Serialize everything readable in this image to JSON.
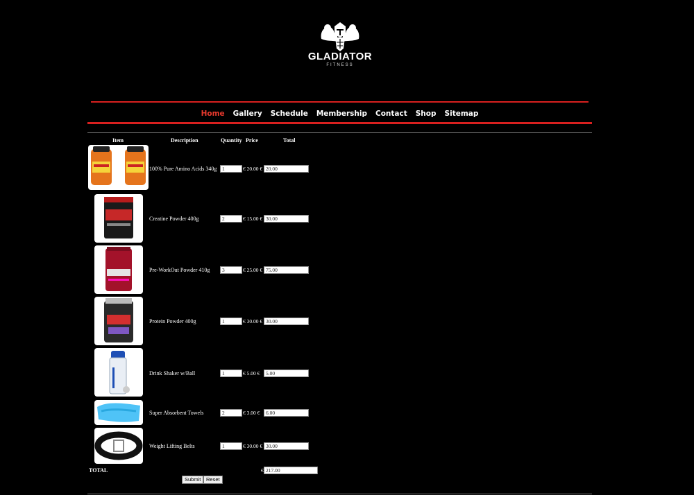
{
  "logo": {
    "brand": "GLADIATOR",
    "sub": "FITNESS"
  },
  "nav": {
    "items": [
      "Home",
      "Gallery",
      "Schedule",
      "Membership",
      "Contact",
      "Shop",
      "Sitemap"
    ],
    "active": "Home"
  },
  "table": {
    "headers": {
      "item": "Item",
      "description": "Description",
      "quantity": "Quantity",
      "price": "Price",
      "total": "Total"
    },
    "rows": [
      {
        "description": "100% Pure Amino Acids 340g",
        "quantity": "1",
        "price": "€ 20.00 €",
        "total": "20.00"
      },
      {
        "description": "Creatine Powder 400g",
        "quantity": "2",
        "price": "€ 15.00 €",
        "total": "30.00"
      },
      {
        "description": "Pre-WorkOut Powder 410g",
        "quantity": "3",
        "price": "€ 25.00 €",
        "total": "75.00"
      },
      {
        "description": "Protein Powder 400g",
        "quantity": "1",
        "price": "€ 30.00 €",
        "total": "30.00"
      },
      {
        "description": "Drink Shaker w/Ball",
        "quantity": "1",
        "price": "€ 5.00  €",
        "total": "5.00"
      },
      {
        "description": "Super Absorbent Towels",
        "quantity": "2",
        "price": "€ 3.00  €",
        "total": "6.00"
      },
      {
        "description": "Weight Lifting Belts",
        "quantity": "1",
        "price": "€ 30.00 €",
        "total": "30.00"
      }
    ]
  },
  "total": {
    "label": "TOTAL",
    "currency": "€",
    "value": "217.00"
  },
  "buttons": {
    "submit": "Submit",
    "reset": "Reset"
  },
  "colors": {
    "accent": "#d9201f",
    "active_nav": "#e8392d"
  }
}
